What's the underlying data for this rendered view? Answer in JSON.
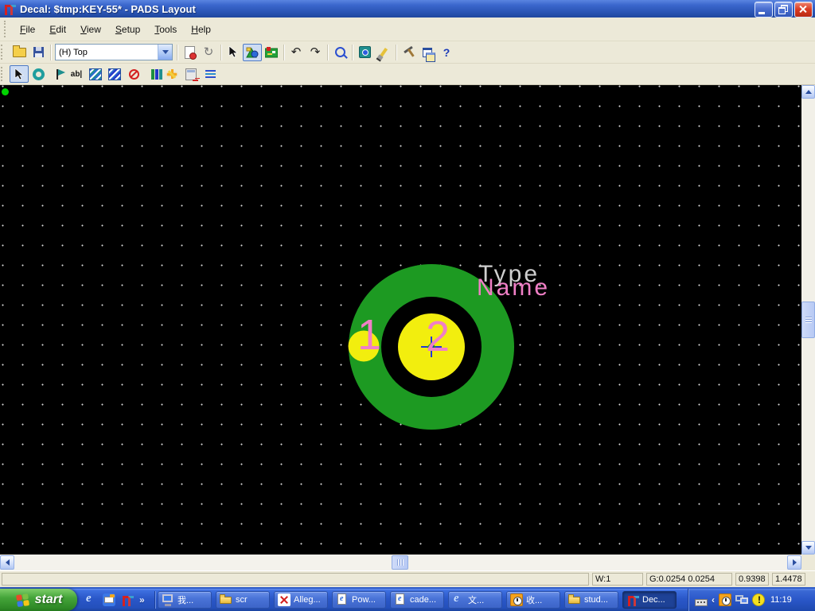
{
  "window": {
    "title": "Decal: $tmp:KEY-55* - PADS Layout"
  },
  "menubar": {
    "items": [
      "File",
      "Edit",
      "View",
      "Setup",
      "Tools",
      "Help"
    ]
  },
  "toolbar_top": {
    "layer_selector_value": "(H) Top",
    "help_label": "?",
    "icons": [
      "open-file",
      "save",
      "layer-selector",
      "decal-properties",
      "reload",
      "select-pointer",
      "drafting-toolbar",
      "pcb-toolbar",
      "undo",
      "redo",
      "zoom",
      "board-overview",
      "redraw-brush",
      "tools-hammer",
      "layers-window",
      "help"
    ]
  },
  "toolbar_drafting": {
    "text_tool_label": "ab|",
    "icons": [
      "select-pointer",
      "pad",
      "terminal-flag",
      "text",
      "copper",
      "copper-pour",
      "keepout",
      "library",
      "flash",
      "dimension",
      "list-view"
    ]
  },
  "canvas": {
    "decal": {
      "pin_labels": [
        "1",
        "2"
      ],
      "type_label": "Type",
      "name_label": "Name"
    },
    "colors": {
      "pad_green": "#1d9a22",
      "pad_yellow": "#f2ee0e",
      "label_pink": "#f07fc6",
      "type_gray": "#cfcfcf",
      "canvas_bg": "#000000"
    }
  },
  "statusbar": {
    "width": "W:1",
    "grid": "G:0.0254 0.0254",
    "x_coord": "0.9398",
    "y_coord": "1.4478"
  },
  "taskbar": {
    "start_label": "start",
    "quick_launch_icons": [
      "internet-explorer",
      "outlook-express",
      "pads-layout"
    ],
    "overflow_glyph": "»",
    "tasks": [
      {
        "label": "我...",
        "icon": "my-computer"
      },
      {
        "label": "scr",
        "icon": "folder"
      },
      {
        "label": "Alleg...",
        "icon": "allegro"
      },
      {
        "label": "Pow...",
        "icon": "html-doc"
      },
      {
        "label": "cade...",
        "icon": "html-doc"
      },
      {
        "label": "文...",
        "icon": "internet-explorer"
      },
      {
        "label": "收...",
        "icon": "scheduler-clock"
      },
      {
        "label": "stud...",
        "icon": "folder"
      },
      {
        "label": "Dec...",
        "icon": "pads-layout",
        "active": true
      }
    ],
    "tray": {
      "collapse_glyph": "‹",
      "icons": [
        "keyboard",
        "scheduler-clock",
        "display",
        "security-alert"
      ],
      "clock": "11:19"
    }
  }
}
